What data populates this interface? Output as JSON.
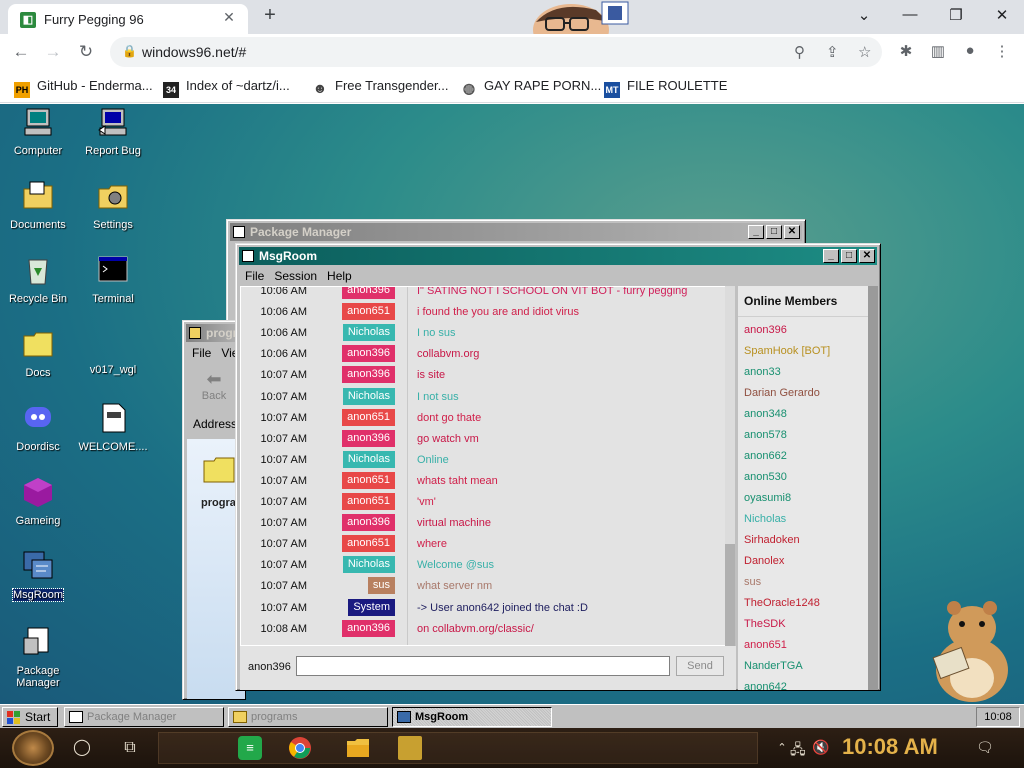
{
  "browser": {
    "tab_title": "Furry Pegging 96",
    "tab_close": "✕",
    "new_tab": "+",
    "url": "windows96.net/#",
    "nav": {
      "back": "←",
      "forward": "→",
      "reload": "↻"
    },
    "window_controls": {
      "dropdown": "⌄",
      "minimize": "—",
      "restore": "❐",
      "close": "✕"
    },
    "bookmarks": [
      {
        "label": "GitHub - Enderma...",
        "icon": "PH",
        "color": "#f0a000"
      },
      {
        "label": "Index of ~dartz/i...",
        "icon": "34",
        "color": "#222222"
      },
      {
        "label": "Free Transgender...",
        "icon": "☻",
        "color": "#444444"
      },
      {
        "label": "GAY RAPE PORN...",
        "icon": "◍",
        "color": "#555555"
      },
      {
        "label": "FILE ROULETTE",
        "icon": "MT",
        "color": "#1a4fa0"
      }
    ]
  },
  "desktop": {
    "icons": [
      {
        "label": "Computer"
      },
      {
        "label": "Report Bug"
      },
      {
        "label": "Documents"
      },
      {
        "label": "Settings"
      },
      {
        "label": "Recycle Bin"
      },
      {
        "label": "Terminal"
      },
      {
        "label": "Docs"
      },
      {
        "label": "v017_wgl"
      },
      {
        "label": "Doordisc"
      },
      {
        "label": "WELCOME...."
      },
      {
        "label": "Gameing"
      },
      {
        "label": "MsgRoom"
      },
      {
        "label": "Package Manager"
      }
    ]
  },
  "package_manager": {
    "title": "Package Manager"
  },
  "explorer": {
    "title": "progr",
    "menu": [
      "File",
      "Vie"
    ],
    "back": "Back",
    "address": "Address",
    "folder_label": "progra"
  },
  "msgroom": {
    "title": "MsgRoom",
    "menu": [
      "File",
      "Session",
      "Help"
    ],
    "messages": [
      {
        "time": "10:06 AM",
        "user": "anon396",
        "user_color": "#e0306a",
        "text": "I\" SATING NOT I SCHOOL ON VIT BOT - furry pegging",
        "text_color": "#d0205a"
      },
      {
        "time": "10:06 AM",
        "user": "anon651",
        "user_color": "#e84848",
        "text": "i found the you are and idiot virus",
        "text_color": "#d0204a"
      },
      {
        "time": "10:06 AM",
        "user": "Nicholas",
        "user_color": "#38b8b0",
        "text": "I no sus",
        "text_color": "#38b0a8"
      },
      {
        "time": "10:06 AM",
        "user": "anon396",
        "user_color": "#e0306a",
        "text": "collabvm.org",
        "text_color": "#c81848"
      },
      {
        "time": "10:07 AM",
        "user": "anon396",
        "user_color": "#e0306a",
        "text": "is site",
        "text_color": "#c81848"
      },
      {
        "time": "10:07 AM",
        "user": "Nicholas",
        "user_color": "#38b8b0",
        "text": "I not sus",
        "text_color": "#38b0a8"
      },
      {
        "time": "10:07 AM",
        "user": "anon651",
        "user_color": "#e84848",
        "text": "dont go thate",
        "text_color": "#d0204a"
      },
      {
        "time": "10:07 AM",
        "user": "anon396",
        "user_color": "#e0306a",
        "text": "go watch vm",
        "text_color": "#c81848"
      },
      {
        "time": "10:07 AM",
        "user": "Nicholas",
        "user_color": "#38b8b0",
        "text": "Online",
        "text_color": "#38b0a8"
      },
      {
        "time": "10:07 AM",
        "user": "anon651",
        "user_color": "#e84848",
        "text": "whats taht mean",
        "text_color": "#d0204a"
      },
      {
        "time": "10:07 AM",
        "user": "anon651",
        "user_color": "#e84848",
        "text": "'vm'",
        "text_color": "#d0204a"
      },
      {
        "time": "10:07 AM",
        "user": "anon396",
        "user_color": "#e0306a",
        "text": "virtual machine",
        "text_color": "#c81848"
      },
      {
        "time": "10:07 AM",
        "user": "anon651",
        "user_color": "#e84848",
        "text": "where",
        "text_color": "#d0204a"
      },
      {
        "time": "10:07 AM",
        "user": "Nicholas",
        "user_color": "#38b8b0",
        "text": "Welcome @sus",
        "text_color": "#38b0a8"
      },
      {
        "time": "10:07 AM",
        "user": "sus",
        "user_color": "#b88060",
        "text": "what server nm",
        "text_color": "#a8786a"
      },
      {
        "time": "10:07 AM",
        "user": "System",
        "user_color": "#1a1a80",
        "text": "-> User anon642 joined the chat :D",
        "text_color": "#202060"
      },
      {
        "time": "10:08 AM",
        "user": "anon396",
        "user_color": "#e0306a",
        "text": "on collabvm.org/classic/",
        "text_color": "#c81848"
      }
    ],
    "members_title": "Online Members",
    "members": [
      {
        "name": "anon396",
        "color": "#c81848"
      },
      {
        "name": "SpamHook [BOT]",
        "color": "#b89020"
      },
      {
        "name": "anon33",
        "color": "#189070"
      },
      {
        "name": "Darian Gerardo",
        "color": "#905040"
      },
      {
        "name": "anon348",
        "color": "#189070"
      },
      {
        "name": "anon578",
        "color": "#189070"
      },
      {
        "name": "anon662",
        "color": "#189070"
      },
      {
        "name": "anon530",
        "color": "#189070"
      },
      {
        "name": "oyasumi8",
        "color": "#189070"
      },
      {
        "name": "Nicholas",
        "color": "#38b0a8"
      },
      {
        "name": "Sirhadoken",
        "color": "#c02030"
      },
      {
        "name": "Danolex",
        "color": "#c02030"
      },
      {
        "name": "sus",
        "color": "#a8786a"
      },
      {
        "name": "TheOracle1248",
        "color": "#c02030"
      },
      {
        "name": "TheSDK",
        "color": "#c81848"
      },
      {
        "name": "anon651",
        "color": "#d0204a"
      },
      {
        "name": "NanderTGA",
        "color": "#189070"
      },
      {
        "name": "anon642",
        "color": "#189070"
      }
    ],
    "nick": "anon396",
    "input_value": "",
    "send_label": "Send"
  },
  "taskbar": {
    "start_label": "Start",
    "buttons": [
      {
        "label": "Package Manager"
      },
      {
        "label": "programs"
      },
      {
        "label": "MsgRoom"
      }
    ],
    "clock": "10:08"
  },
  "win10": {
    "clock": "10:08 AM"
  }
}
